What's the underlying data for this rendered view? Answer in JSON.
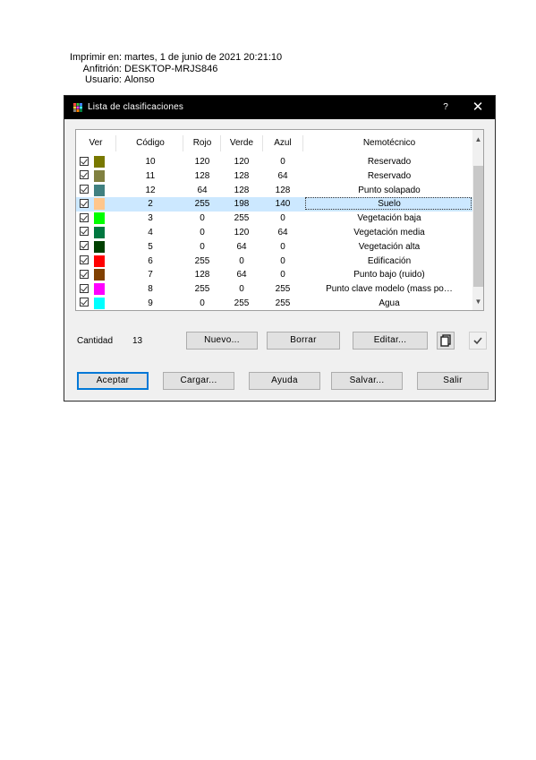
{
  "print_info": {
    "printed_label": "Imprimir en:",
    "printed_value": "martes, 1 de junio de 2021 20:21:10",
    "host_label": "Anfitrión:",
    "host_value": "DESKTOP-MRJS846",
    "user_label": "Usuario:",
    "user_value": "Alonso"
  },
  "dialog": {
    "title": "Lista de clasificaciones",
    "help_label": "?",
    "close_label": "✕"
  },
  "grid": {
    "columns": [
      "Ver",
      "Código",
      "Rojo",
      "Verde",
      "Azul",
      "Nemotécnico"
    ],
    "rows": [
      {
        "visible": true,
        "code": "10",
        "red": "120",
        "green": "120",
        "blue": "0",
        "name": "Reservado",
        "color": "#787800"
      },
      {
        "visible": true,
        "code": "11",
        "red": "128",
        "green": "128",
        "blue": "64",
        "name": "Reservado",
        "color": "#808040"
      },
      {
        "visible": true,
        "code": "12",
        "red": "64",
        "green": "128",
        "blue": "128",
        "name": "Punto solapado",
        "color": "#408080"
      },
      {
        "visible": true,
        "code": "2",
        "red": "255",
        "green": "198",
        "blue": "140",
        "name": "Suelo",
        "color": "#ffc68c",
        "selected": true
      },
      {
        "visible": true,
        "code": "3",
        "red": "0",
        "green": "255",
        "blue": "0",
        "name": "Vegetación baja",
        "color": "#00ff00"
      },
      {
        "visible": true,
        "code": "4",
        "red": "0",
        "green": "120",
        "blue": "64",
        "name": "Vegetación media",
        "color": "#007840"
      },
      {
        "visible": true,
        "code": "5",
        "red": "0",
        "green": "64",
        "blue": "0",
        "name": "Vegetación alta",
        "color": "#004000"
      },
      {
        "visible": true,
        "code": "6",
        "red": "255",
        "green": "0",
        "blue": "0",
        "name": "Edificación",
        "color": "#ff0000"
      },
      {
        "visible": true,
        "code": "7",
        "red": "128",
        "green": "64",
        "blue": "0",
        "name": "Punto bajo (ruido)",
        "color": "#804000"
      },
      {
        "visible": true,
        "code": "8",
        "red": "255",
        "green": "0",
        "blue": "255",
        "name": "Punto clave modelo (mass po…",
        "color": "#ff00ff"
      },
      {
        "visible": true,
        "code": "9",
        "red": "0",
        "green": "255",
        "blue": "255",
        "name": "Agua",
        "color": "#00ffff"
      }
    ]
  },
  "count": {
    "label": "Cantidad",
    "value": "13"
  },
  "buttons": {
    "new": "Nuevo...",
    "delete": "Borrar",
    "edit": "Editar...",
    "accept": "Aceptar",
    "load": "Cargar...",
    "help": "Ayuda",
    "save": "Salvar...",
    "exit": "Salir"
  },
  "icons": {
    "copy": "copy-icon",
    "check": "checkmark-icon",
    "app": "palette-icon"
  }
}
